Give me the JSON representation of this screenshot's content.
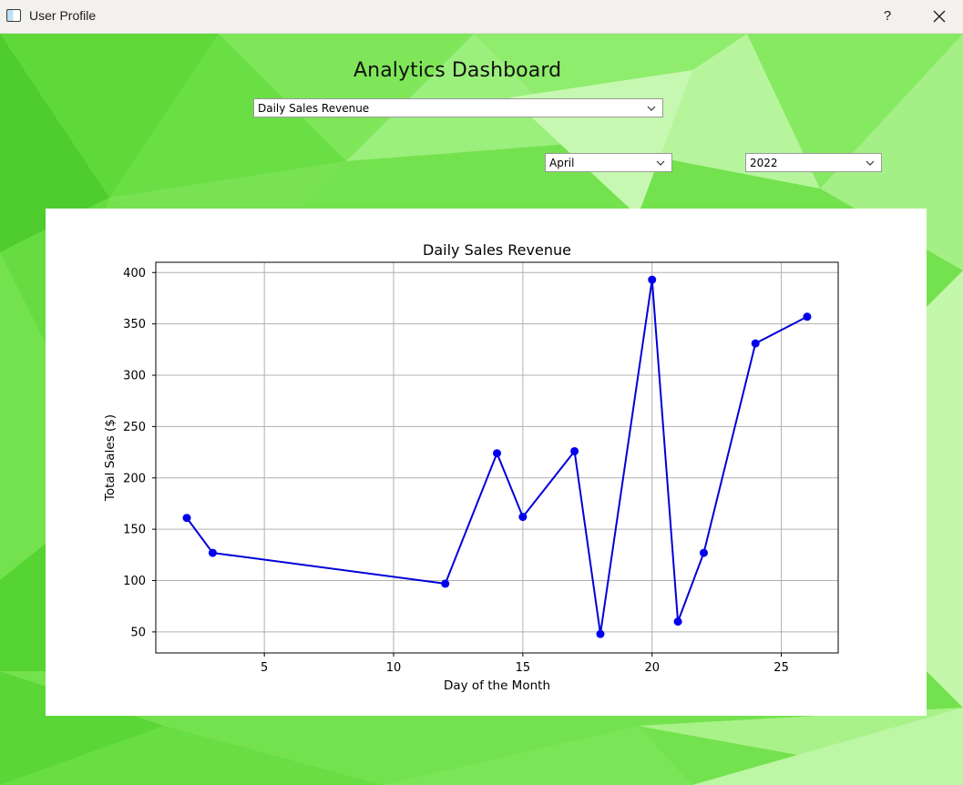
{
  "window": {
    "title": "User Profile",
    "help_label": "?"
  },
  "dashboard": {
    "title": "Analytics Dashboard",
    "metric_select": {
      "value": "Daily Sales Revenue"
    },
    "month_select": {
      "value": "April"
    },
    "year_select": {
      "value": "2022"
    }
  },
  "colors": {
    "background_green": "#74e24e",
    "line": "#0000d8",
    "marker": "#0000ee",
    "grid": "#b0b0b0"
  },
  "chart_data": {
    "type": "line",
    "title": "Daily Sales Revenue",
    "xlabel": "Day of the Month",
    "ylabel": "Total Sales ($)",
    "x": [
      2,
      3,
      12,
      14,
      15,
      17,
      18,
      20,
      21,
      22,
      24,
      26
    ],
    "series": [
      {
        "values": [
          161,
          127,
          97,
          224,
          162,
          226,
          48,
          393,
          60,
          127,
          331,
          357
        ]
      }
    ],
    "xlim": [
      0.8,
      27.2
    ],
    "ylim": [
      29.5,
      410
    ],
    "xticks": [
      5,
      10,
      15,
      20,
      25
    ],
    "yticks": [
      50,
      100,
      150,
      200,
      250,
      300,
      350,
      400
    ],
    "grid": true,
    "markers": "circle"
  }
}
